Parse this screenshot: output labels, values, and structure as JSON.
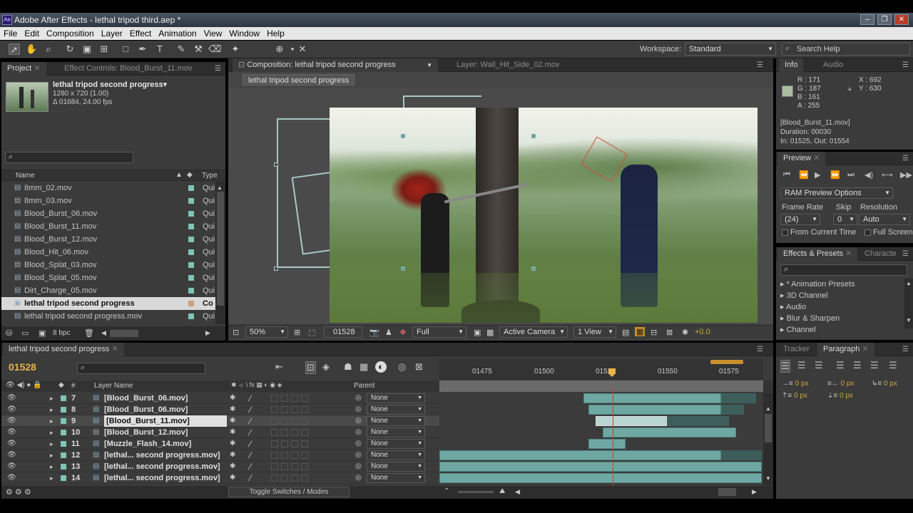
{
  "window": {
    "title": "Adobe After Effects - lethal tripod third.aep *"
  },
  "menu": [
    "File",
    "Edit",
    "Composition",
    "Layer",
    "Effect",
    "Animation",
    "View",
    "Window",
    "Help"
  ],
  "toolbar": {
    "workspace_label": "Workspace:",
    "workspace_value": "Standard",
    "search_placeholder": "Search Help"
  },
  "project": {
    "tab_project": "Project",
    "tab_effect_controls": "Effect Controls: Blood_Burst_11.mov",
    "comp_name": "lethal tripod second progress▾",
    "comp_size": "1280 x 720 (1.00)",
    "comp_duration": "Δ 01684, 24.00 fps",
    "col_name": "Name",
    "col_type": "Type",
    "items": [
      {
        "name": "8mm_02.mov",
        "type": "Qui",
        "color": "#7fc4b8"
      },
      {
        "name": "8mm_03.mov",
        "type": "Qui",
        "color": "#7fc4b8"
      },
      {
        "name": "Blood_Burst_06.mov",
        "type": "Qui",
        "color": "#7fc4b8"
      },
      {
        "name": "Blood_Burst_11.mov",
        "type": "Qui",
        "color": "#7fc4b8"
      },
      {
        "name": "Blood_Burst_12.mov",
        "type": "Qui",
        "color": "#7fc4b8"
      },
      {
        "name": "Blood_Hit_06.mov",
        "type": "Qui",
        "color": "#7fc4b8"
      },
      {
        "name": "Blood_Splat_03.mov",
        "type": "Qui",
        "color": "#7fc4b8"
      },
      {
        "name": "Blood_Splat_05.mov",
        "type": "Qui",
        "color": "#7fc4b8"
      },
      {
        "name": "Dirt_Charge_05.mov",
        "type": "Qui",
        "color": "#7fc4b8"
      },
      {
        "name": "lethal tripod second progress",
        "type": "Co",
        "color": "#c9a27a"
      },
      {
        "name": "lethal tripod second progress.mov",
        "type": "Qui",
        "color": "#7fc4b8"
      }
    ],
    "bpc": "8 bpc"
  },
  "composition": {
    "tab_comp": "Composition: lethal tripod second progress",
    "tab_layer": "Layer: Wall_Hit_Side_02.mov",
    "breadcrumb": "lethal tripod second progress",
    "zoom": "50%",
    "timecode": "01528",
    "resolution": "Full",
    "camera": "Active Camera",
    "view": "1 View",
    "exposure": "+0.0"
  },
  "info": {
    "tab_info": "Info",
    "tab_audio": "Audio",
    "r": "R : 171",
    "g": "G : 187",
    "b": "B : 161",
    "a": "A : 255",
    "x": "X : 692",
    "y": "Y : 630",
    "layer": "[Blood_Burst_11.mov]",
    "duration": "Duration: 00030",
    "inout": "In: 01525, Out: 01554",
    "swatch_color": "#abbba1"
  },
  "preview": {
    "tab": "Preview",
    "ram_options": "RAM Preview Options",
    "frame_rate_label": "Frame Rate",
    "skip_label": "Skip",
    "resolution_label": "Resolution",
    "frame_rate": "(24)",
    "skip": "0",
    "resolution": "Auto",
    "from_current": "From Current Time",
    "full_screen": "Full Screen"
  },
  "effects": {
    "tab": "Effects & Presets",
    "tab2": "Characte",
    "items": [
      "* Animation Presets",
      "3D Channel",
      "Audio",
      "Blur & Sharpen",
      "Channel"
    ]
  },
  "timeline": {
    "tab": "lethal tripod second progress",
    "timecode": "01528",
    "col_layer_name": "Layer Name",
    "col_parent": "Parent",
    "ruler": [
      "01475",
      "01500",
      "01525",
      "01550",
      "01575"
    ],
    "toggle": "Toggle Switches / Modes",
    "layers": [
      {
        "num": "7",
        "name": "[Blood_Burst_06.mov]",
        "parent": "None",
        "color": "#7fc4b8"
      },
      {
        "num": "8",
        "name": "[Blood_Burst_06.mov]",
        "parent": "None",
        "color": "#7fc4b8"
      },
      {
        "num": "9",
        "name": "[Blood_Burst_11.mov]",
        "parent": "None",
        "color": "#7fc4b8"
      },
      {
        "num": "10",
        "name": "[Blood_Burst_12.mov]",
        "parent": "None",
        "color": "#7fc4b8"
      },
      {
        "num": "11",
        "name": "[Muzzle_Flash_14.mov]",
        "parent": "None",
        "color": "#7fc4b8"
      },
      {
        "num": "12",
        "name": "[lethal... second progress.mov]",
        "parent": "None",
        "color": "#7fc4b8"
      },
      {
        "num": "13",
        "name": "[lethal... second progress.mov]",
        "parent": "None",
        "color": "#7fc4b8"
      },
      {
        "num": "14",
        "name": "[lethal... second progress.mov]",
        "parent": "None",
        "color": "#7fc4b8"
      }
    ]
  },
  "paragraph": {
    "tab_tracker": "Tracker",
    "tab_paragraph": "Paragraph",
    "v1": "0 px",
    "v2": "0 px",
    "v3": "0 px",
    "v4": "0 px",
    "v5": "0 px"
  },
  "accent": "#e8b34a"
}
